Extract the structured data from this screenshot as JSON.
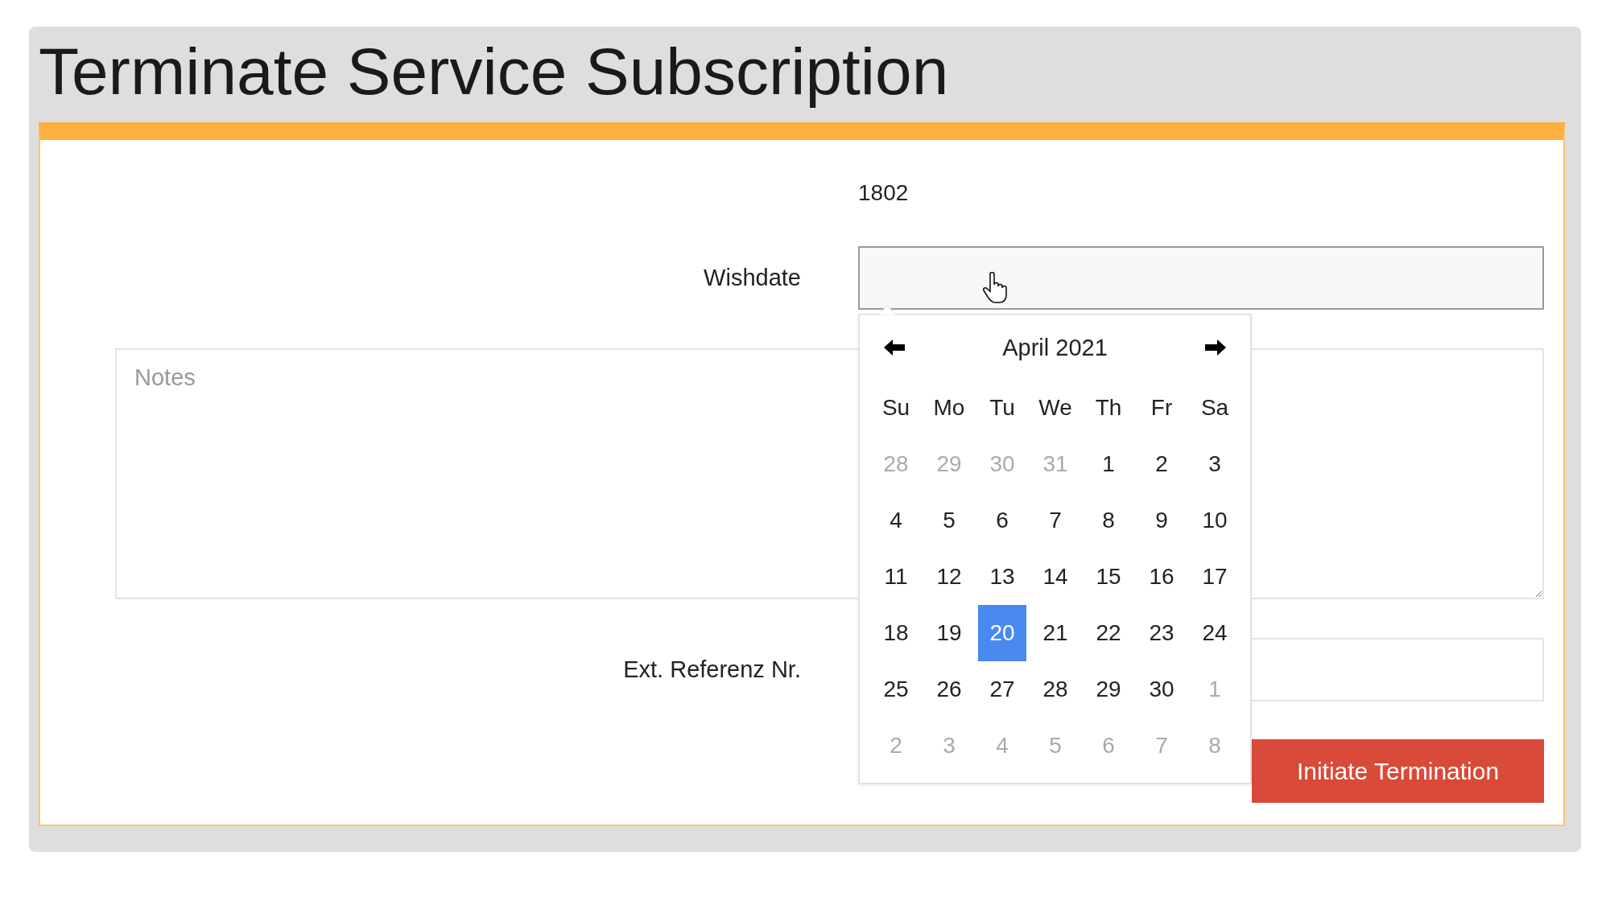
{
  "page": {
    "title": "Terminate Service Subscription"
  },
  "form": {
    "id_value": "1802",
    "wishdate": {
      "label": "Wishdate"
    },
    "notes": {
      "placeholder": "Notes"
    },
    "ext_ref": {
      "label": "Ext. Referenz Nr."
    },
    "submit_button": "Initiate Termination"
  },
  "datepicker": {
    "month_title": "April 2021",
    "weekdays": [
      "Su",
      "Mo",
      "Tu",
      "We",
      "Th",
      "Fr",
      "Sa"
    ],
    "weeks": [
      [
        {
          "day": "28",
          "muted": true,
          "selected": false
        },
        {
          "day": "29",
          "muted": true,
          "selected": false
        },
        {
          "day": "30",
          "muted": true,
          "selected": false
        },
        {
          "day": "31",
          "muted": true,
          "selected": false
        },
        {
          "day": "1",
          "muted": false,
          "selected": false
        },
        {
          "day": "2",
          "muted": false,
          "selected": false
        },
        {
          "day": "3",
          "muted": false,
          "selected": false
        }
      ],
      [
        {
          "day": "4",
          "muted": false,
          "selected": false
        },
        {
          "day": "5",
          "muted": false,
          "selected": false
        },
        {
          "day": "6",
          "muted": false,
          "selected": false
        },
        {
          "day": "7",
          "muted": false,
          "selected": false
        },
        {
          "day": "8",
          "muted": false,
          "selected": false
        },
        {
          "day": "9",
          "muted": false,
          "selected": false
        },
        {
          "day": "10",
          "muted": false,
          "selected": false
        }
      ],
      [
        {
          "day": "11",
          "muted": false,
          "selected": false
        },
        {
          "day": "12",
          "muted": false,
          "selected": false
        },
        {
          "day": "13",
          "muted": false,
          "selected": false
        },
        {
          "day": "14",
          "muted": false,
          "selected": false
        },
        {
          "day": "15",
          "muted": false,
          "selected": false
        },
        {
          "day": "16",
          "muted": false,
          "selected": false
        },
        {
          "day": "17",
          "muted": false,
          "selected": false
        }
      ],
      [
        {
          "day": "18",
          "muted": false,
          "selected": false
        },
        {
          "day": "19",
          "muted": false,
          "selected": false
        },
        {
          "day": "20",
          "muted": false,
          "selected": true
        },
        {
          "day": "21",
          "muted": false,
          "selected": false
        },
        {
          "day": "22",
          "muted": false,
          "selected": false
        },
        {
          "day": "23",
          "muted": false,
          "selected": false
        },
        {
          "day": "24",
          "muted": false,
          "selected": false
        }
      ],
      [
        {
          "day": "25",
          "muted": false,
          "selected": false
        },
        {
          "day": "26",
          "muted": false,
          "selected": false
        },
        {
          "day": "27",
          "muted": false,
          "selected": false
        },
        {
          "day": "28",
          "muted": false,
          "selected": false
        },
        {
          "day": "29",
          "muted": false,
          "selected": false
        },
        {
          "day": "30",
          "muted": false,
          "selected": false
        },
        {
          "day": "1",
          "muted": true,
          "selected": false
        }
      ],
      [
        {
          "day": "2",
          "muted": true,
          "selected": false
        },
        {
          "day": "3",
          "muted": true,
          "selected": false
        },
        {
          "day": "4",
          "muted": true,
          "selected": false
        },
        {
          "day": "5",
          "muted": true,
          "selected": false
        },
        {
          "day": "6",
          "muted": true,
          "selected": false
        },
        {
          "day": "7",
          "muted": true,
          "selected": false
        },
        {
          "day": "8",
          "muted": true,
          "selected": false
        }
      ]
    ]
  }
}
